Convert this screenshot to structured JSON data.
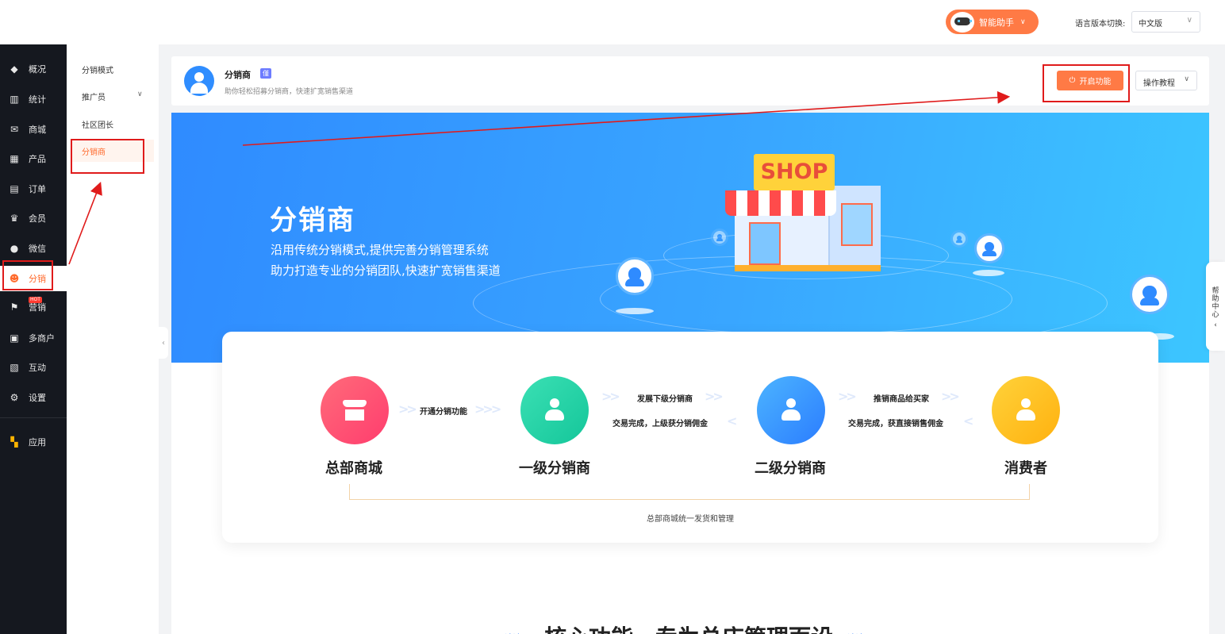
{
  "topbar": {
    "assistant_label": "智能助手",
    "language_label": "语言版本切换:",
    "language_value": "中文版"
  },
  "sidebar": {
    "items": [
      {
        "label": "概况",
        "icon": "graduation-cap-icon"
      },
      {
        "label": "统计",
        "icon": "chart-icon"
      },
      {
        "label": "商城",
        "icon": "mail-icon"
      },
      {
        "label": "产品",
        "icon": "grid-icon"
      },
      {
        "label": "订单",
        "icon": "clipboard-icon"
      },
      {
        "label": "会员",
        "icon": "crown-icon"
      },
      {
        "label": "微信",
        "icon": "chat-icon"
      },
      {
        "label": "分销",
        "icon": "users-icon"
      },
      {
        "label": "营销",
        "icon": "flag-icon",
        "badge": "HOT"
      },
      {
        "label": "多商户",
        "icon": "merchant-icon"
      },
      {
        "label": "互动",
        "icon": "interact-icon"
      },
      {
        "label": "设置",
        "icon": "gear-icon"
      },
      {
        "label": "应用",
        "icon": "apps-icon"
      }
    ]
  },
  "subnav": {
    "items": [
      {
        "label": "分销模式"
      },
      {
        "label": "推广员"
      },
      {
        "label": "社区团长"
      },
      {
        "label": "分销商"
      }
    ]
  },
  "header": {
    "title": "分销商",
    "badge": "僅",
    "subtitle": "助你轻松招募分销商，快速扩宽销售渠道",
    "open_label": "开启功能",
    "tutorial_label": "操作教程"
  },
  "banner": {
    "title": "分销商",
    "line1": "沿用传统分销模式,提供完善分销管理系统",
    "line2": "助力打造专业的分销团队,快速扩宽销售渠道",
    "shop_sign": "SHOP"
  },
  "flow": {
    "nodes": [
      "总部商城",
      "一级分销商",
      "二级分销商",
      "消费者"
    ],
    "step1": "开通分销功能",
    "step2_top": "发展下级分销商",
    "step2_bottom": "交易完成，上级获分销佣金",
    "step3_top": "推销商品给买家",
    "step3_bottom": "交易完成，获直接销售佣金",
    "footer": "总部商城统一发货和管理"
  },
  "core": {
    "title": "核心功能，专为总店管理而设"
  },
  "help": {
    "label": [
      "帮",
      "助",
      "中",
      "心"
    ]
  },
  "colors": {
    "accent": "#ff7a45",
    "sidebar_bg": "#15181f",
    "annotation": "#e01b1b"
  }
}
